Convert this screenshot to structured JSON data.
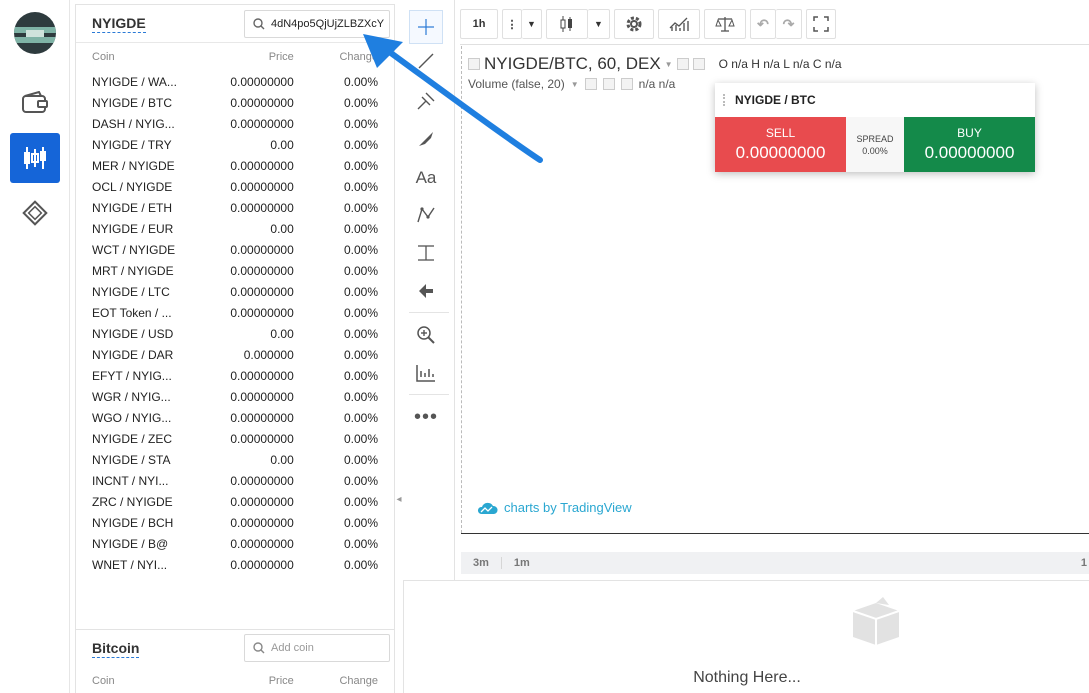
{
  "markets_primary": {
    "title": "NYIGDE",
    "search_value": "4dN4po5QjUjZLBZXcY",
    "headers": {
      "coin": "Coin",
      "price": "Price",
      "change": "Change"
    },
    "rows": [
      {
        "coin": "NYIGDE / WA...",
        "price": "0.00000000",
        "change": "0.00%"
      },
      {
        "coin": "NYIGDE / BTC",
        "price": "0.00000000",
        "change": "0.00%"
      },
      {
        "coin": "DASH / NYIG...",
        "price": "0.00000000",
        "change": "0.00%"
      },
      {
        "coin": "NYIGDE / TRY",
        "price": "0.00",
        "change": "0.00%"
      },
      {
        "coin": "MER / NYIGDE",
        "price": "0.00000000",
        "change": "0.00%"
      },
      {
        "coin": "OCL / NYIGDE",
        "price": "0.00000000",
        "change": "0.00%"
      },
      {
        "coin": "NYIGDE / ETH",
        "price": "0.00000000",
        "change": "0.00%"
      },
      {
        "coin": "NYIGDE / EUR",
        "price": "0.00",
        "change": "0.00%"
      },
      {
        "coin": "WCT / NYIGDE",
        "price": "0.00000000",
        "change": "0.00%"
      },
      {
        "coin": "MRT / NYIGDE",
        "price": "0.00000000",
        "change": "0.00%"
      },
      {
        "coin": "NYIGDE / LTC",
        "price": "0.00000000",
        "change": "0.00%"
      },
      {
        "coin": "EOT Token / ...",
        "price": "0.00000000",
        "change": "0.00%"
      },
      {
        "coin": "NYIGDE / USD",
        "price": "0.00",
        "change": "0.00%"
      },
      {
        "coin": "NYIGDE / DAR",
        "price": "0.000000",
        "change": "0.00%"
      },
      {
        "coin": "EFYT / NYIG...",
        "price": "0.00000000",
        "change": "0.00%"
      },
      {
        "coin": "WGR / NYIG...",
        "price": "0.00000000",
        "change": "0.00%"
      },
      {
        "coin": "WGO / NYIG...",
        "price": "0.00000000",
        "change": "0.00%"
      },
      {
        "coin": "NYIGDE / ZEC",
        "price": "0.00000000",
        "change": "0.00%"
      },
      {
        "coin": "NYIGDE / STA",
        "price": "0.00",
        "change": "0.00%"
      },
      {
        "coin": "INCNT / NYI...",
        "price": "0.00000000",
        "change": "0.00%"
      },
      {
        "coin": "ZRC / NYIGDE",
        "price": "0.00000000",
        "change": "0.00%"
      },
      {
        "coin": "NYIGDE / BCH",
        "price": "0.00000000",
        "change": "0.00%"
      },
      {
        "coin": "NYIGDE / B@",
        "price": "0.00000000",
        "change": "0.00%"
      },
      {
        "coin": "WNET / NYI...",
        "price": "0.00000000",
        "change": "0.00%"
      }
    ]
  },
  "markets_secondary": {
    "title": "Bitcoin",
    "search_placeholder": "Add coin",
    "headers": {
      "coin": "Coin",
      "price": "Price",
      "change": "Change"
    }
  },
  "toolbar": {
    "interval": "1h"
  },
  "chart": {
    "symbol": "NYIGDE/BTC, 60, DEX",
    "ohlc": "O n/a H n/a L n/a C n/a",
    "volume_label": "Volume (false, 20)",
    "volume_values": "n/a n/a",
    "brand": "charts by TradingView",
    "ranges": [
      "3m",
      "1m"
    ],
    "edge_label": "1"
  },
  "trade": {
    "pair": "NYIGDE / BTC",
    "sell_label": "SELL",
    "sell_value": "0.00000000",
    "spread_label": "SPREAD",
    "spread_value": "0.00%",
    "buy_label": "BUY",
    "buy_value": "0.00000000"
  },
  "empty_panel": {
    "message": "Nothing Here..."
  },
  "colors": {
    "accent": "#1565d8",
    "sell": "#e84b4e",
    "buy": "#148a4a",
    "arrow": "#1f7fe0"
  }
}
